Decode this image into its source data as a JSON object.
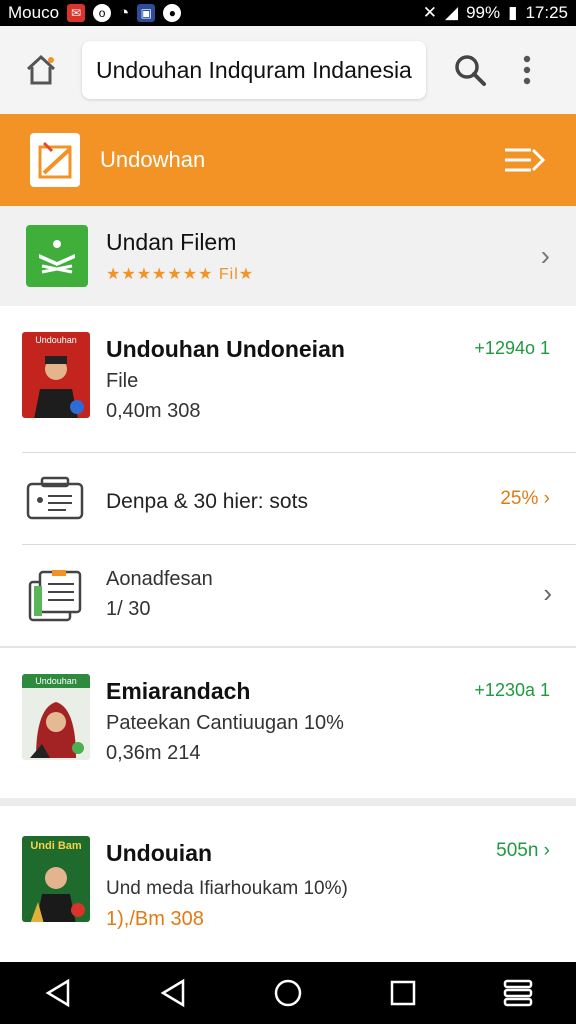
{
  "status_bar": {
    "carrier": "Mouco",
    "battery": "99%",
    "time": "17:25"
  },
  "app_bar": {
    "search_value": "Undouhan Indquram Indanesia"
  },
  "header": {
    "title": "Undowhan"
  },
  "featured": {
    "title": "Undan Filem",
    "rating_stars": "★★★★★★★",
    "rating_label": "Fil★"
  },
  "items": [
    {
      "title": "Undouhan Undoneian",
      "subtitle": "File",
      "meta": "0,40m 308",
      "right": "+1294o 1",
      "thumb_caption": "Undouhan"
    },
    {
      "label": "Denpa & 30 hier: sots",
      "right": "25% ›"
    },
    {
      "label": "Aonadfesan",
      "sub": "1/ 30"
    },
    {
      "title": "Emiarandach",
      "subtitle": "Pateekan Cantiuugan 10%",
      "meta": "0,36m 214",
      "right": "+1230a 1",
      "thumb_caption": "Undouhan"
    },
    {
      "title": "Undouian",
      "subtitle": "Und meda Ifiarhoukam 10%)",
      "meta": "1),/Bm 308",
      "right": "505n ›",
      "thumb_caption": "Undi Bam"
    }
  ]
}
